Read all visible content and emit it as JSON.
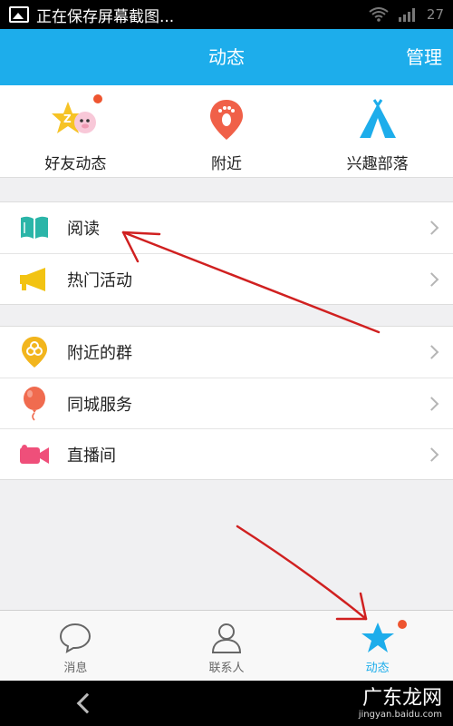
{
  "status_bar": {
    "notification_text": "正在保存屏幕截图...",
    "time": "27"
  },
  "header": {
    "title": "动态",
    "manage_label": "管理"
  },
  "top_entries": [
    {
      "label": "好友动态",
      "icon": "friend-star-icon",
      "badge": true
    },
    {
      "label": "附近",
      "icon": "nearby-footprint-icon",
      "badge": false
    },
    {
      "label": "兴趣部落",
      "icon": "tribe-tent-icon",
      "badge": false
    }
  ],
  "group1": [
    {
      "label": "阅读",
      "icon": "book-icon"
    },
    {
      "label": "热门活动",
      "icon": "megaphone-icon"
    }
  ],
  "group2": [
    {
      "label": "附近的群",
      "icon": "nearby-group-icon"
    },
    {
      "label": "同城服务",
      "icon": "balloon-icon"
    },
    {
      "label": "直播间",
      "icon": "video-camera-icon"
    }
  ],
  "tabs": [
    {
      "label": "消息",
      "icon": "chat-bubble-icon",
      "active": false
    },
    {
      "label": "联系人",
      "icon": "contact-person-icon",
      "active": false
    },
    {
      "label": "动态",
      "icon": "star-icon",
      "active": true
    }
  ],
  "watermark": {
    "main": "广东龙网",
    "sub": "jingyan.baidu.com"
  },
  "colors": {
    "accent": "#1dadeb",
    "badge": "#ee5530",
    "annotation": "#d02020"
  }
}
